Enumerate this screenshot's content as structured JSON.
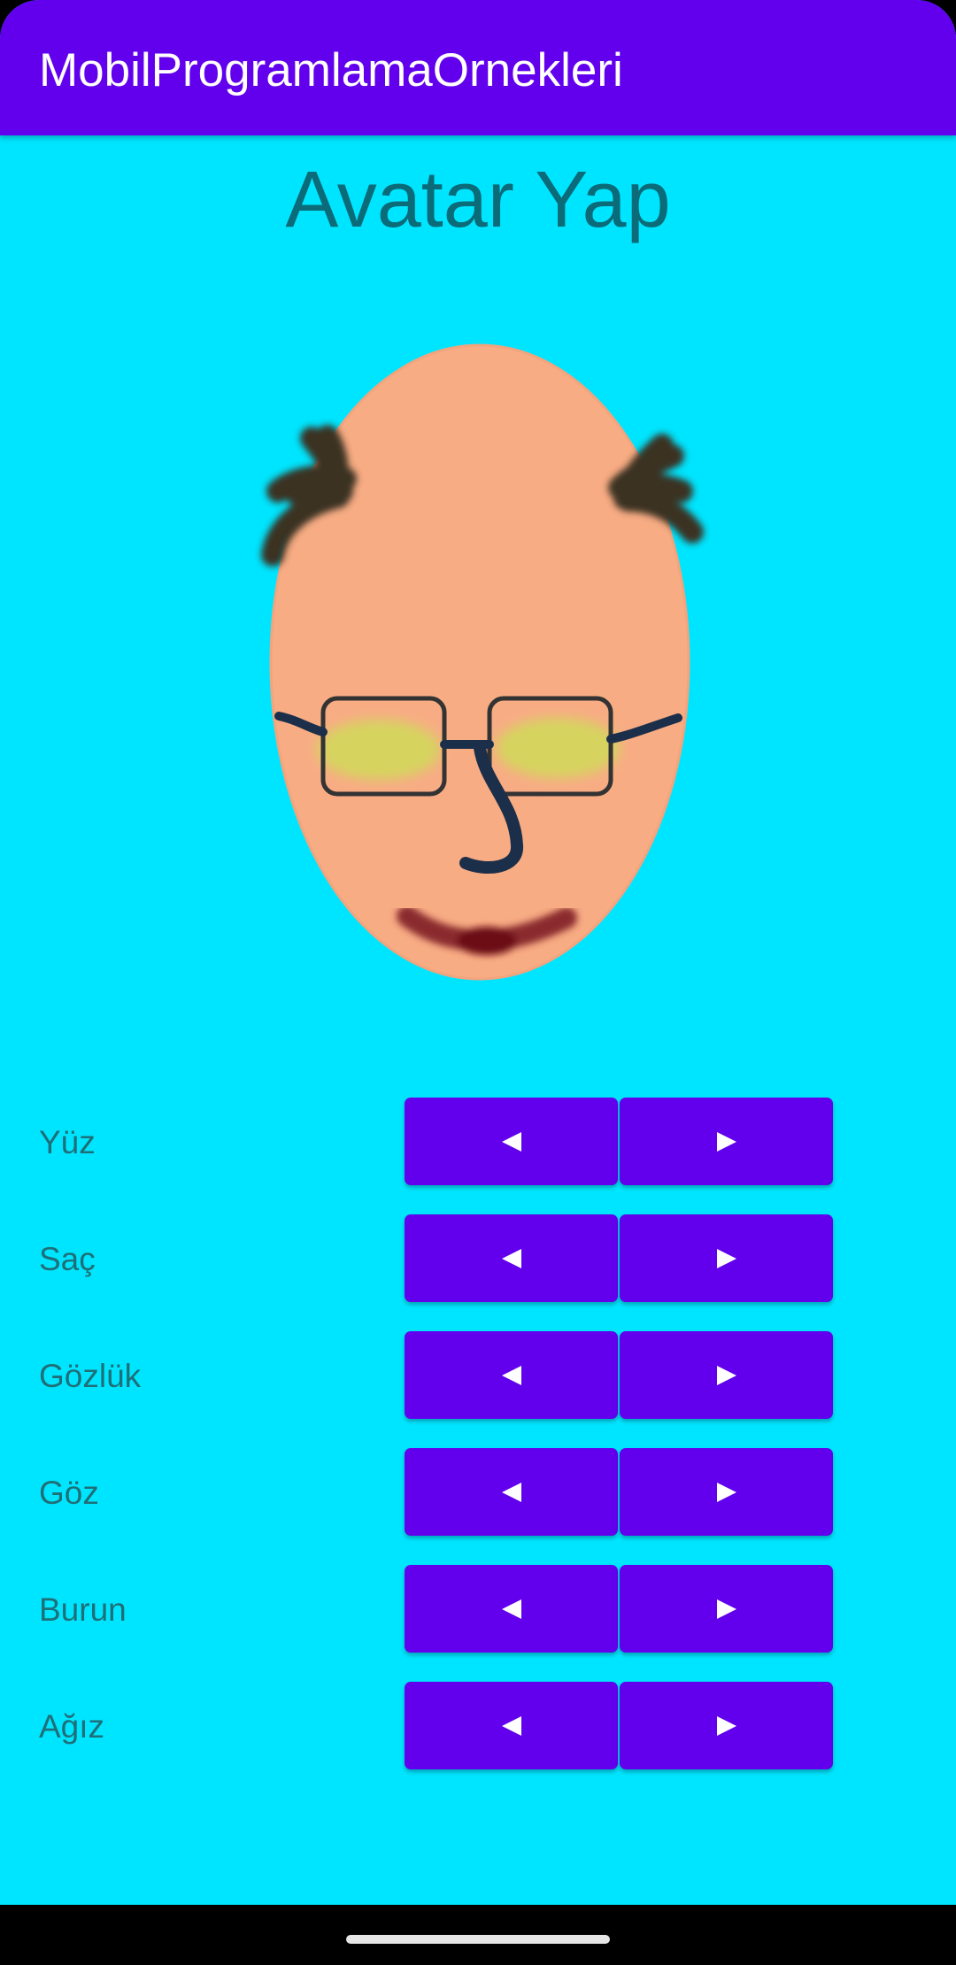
{
  "app_bar": {
    "title": "MobilProgramlamaOrnekleri"
  },
  "page": {
    "heading": "Avatar Yap"
  },
  "controls": [
    {
      "label": "Yüz"
    },
    {
      "label": "Saç"
    },
    {
      "label": "Gözlük"
    },
    {
      "label": "Göz"
    },
    {
      "label": "Burun"
    },
    {
      "label": "Ağız"
    }
  ],
  "icons": {
    "prev": "triangle-left-icon",
    "next": "triangle-right-icon"
  },
  "colors": {
    "app_bar": "#6200ee",
    "background": "#00e5ff",
    "button": "#6200ee",
    "heading_text": "#0b6b78",
    "label_text": "#1f6f78",
    "face": "#f8ac84",
    "hair": "#3a3024",
    "glasses_frame": "#333333",
    "eyes": "#d6d45e",
    "nose": "#1c2f4a",
    "mouth": "#7a1420"
  }
}
